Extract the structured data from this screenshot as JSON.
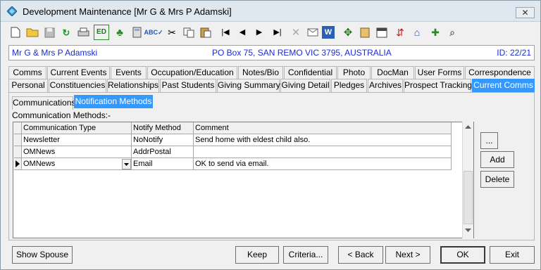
{
  "window": {
    "title": "Development Maintenance  [Mr G & Mrs P Adamski]",
    "close_glyph": "✕"
  },
  "toolbar": {
    "icons": [
      "new-icon",
      "open-folder-icon",
      "save-icon",
      "refresh-icon",
      "print-icon",
      "edit-icon",
      "tree-icon",
      "calculator-icon",
      "spellcheck-icon",
      "cut-icon",
      "copy-icon",
      "paste-icon",
      "first-record-icon",
      "previous-record-icon",
      "next-record-icon",
      "last-record-icon",
      "delete-icon",
      "email-icon",
      "word-icon",
      "network-icon",
      "clipboard-icon",
      "calendar-icon",
      "move-icon",
      "tag-icon",
      "add-note-icon",
      "search-preview-icon"
    ],
    "edit_label": "ED"
  },
  "info": {
    "name": "Mr G & Mrs P Adamski",
    "address": "PO Box 75, SAN REMO VIC 3795, AUSTRALIA",
    "id": "ID: 22/21"
  },
  "tabs_row1": [
    "Comms",
    "Current Events",
    "Events",
    "Occupation/Education",
    "Notes/Bio",
    "Confidential",
    "Photo",
    "DocMan",
    "User Forms",
    "Correspondence"
  ],
  "tabs_row2": [
    "Personal",
    "Constituencies",
    "Relationships",
    "Past Students",
    "Giving Summary",
    "Giving Detail",
    "Pledges",
    "Archives",
    "Prospect Tracking",
    "Current Comms"
  ],
  "active_tab": "Current Comms",
  "subtabs": [
    "Communications",
    "Notification Methods"
  ],
  "active_subtab": "Notification Methods",
  "group_label": "Communication Methods:-",
  "grid": {
    "headers": [
      "Communication Type",
      "Notify Method",
      "Comment"
    ],
    "rows": [
      {
        "type": "Newsletter",
        "method": "NoNotify",
        "comment": "Send home with eldest child also."
      },
      {
        "type": "OMNews",
        "method": "AddrPostal",
        "comment": ""
      },
      {
        "type": "OMNews",
        "method": "Email",
        "comment": "OK to send via email."
      }
    ]
  },
  "side_buttons": {
    "ellipsis": "...",
    "add": "Add",
    "delete": "Delete"
  },
  "bottom_buttons": {
    "show_spouse": "Show Spouse",
    "keep": "Keep",
    "criteria": "Criteria...",
    "back": "< Back",
    "next": "Next >",
    "ok": "OK",
    "exit": "Exit"
  }
}
